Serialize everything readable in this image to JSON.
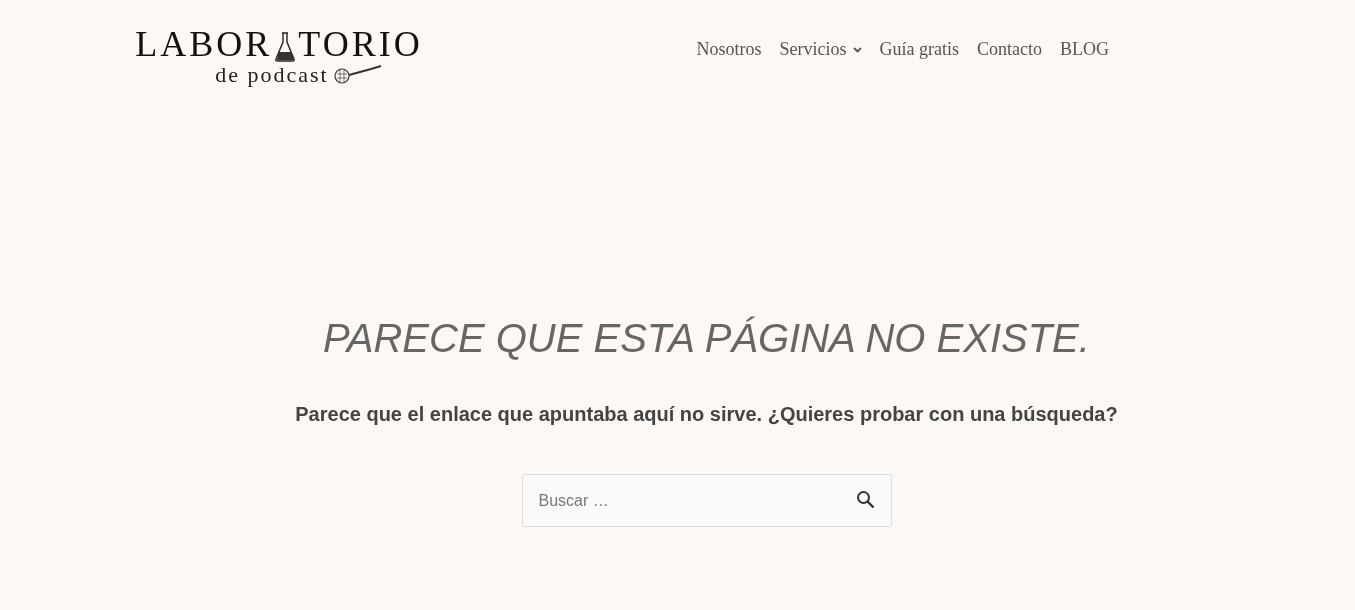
{
  "logo": {
    "word_before": "LABOR",
    "word_after": "TORIO",
    "tagline": "de podcast"
  },
  "nav": [
    {
      "label": "Nosotros",
      "has_submenu": false
    },
    {
      "label": "Servicios",
      "has_submenu": true
    },
    {
      "label": "Guía gratis",
      "has_submenu": false
    },
    {
      "label": "Contacto",
      "has_submenu": false
    },
    {
      "label": "BLOG",
      "has_submenu": false
    }
  ],
  "heading": "PARECE QUE ESTA PÁGINA NO EXISTE.",
  "message": "Parece que el enlace que apuntaba aquí no sirve. ¿Quieres probar con una búsqueda?",
  "search": {
    "placeholder": "Buscar …"
  }
}
